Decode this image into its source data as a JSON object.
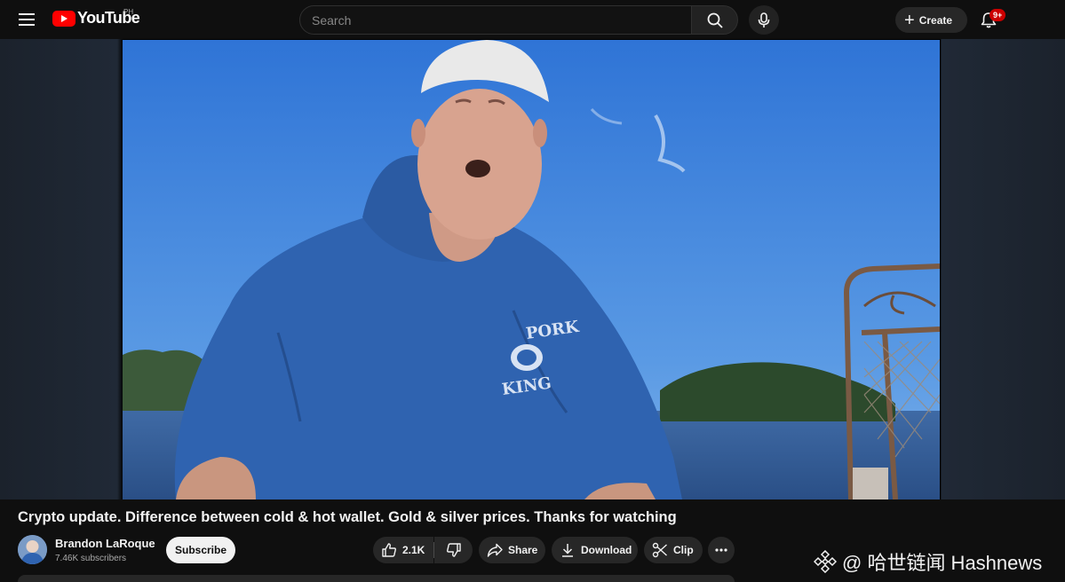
{
  "header": {
    "logo_text": "YouTube",
    "country_code": "PH",
    "search_placeholder": "Search",
    "create_label": "Create",
    "notification_count": "9+"
  },
  "video": {
    "title": "Crypto update. Difference between cold & hot wallet. Gold & silver prices. Thanks for watching",
    "hoodie_text_top": "PORK",
    "hoodie_text_bottom": "KING"
  },
  "channel": {
    "name": "Brandon LaRoque",
    "subscribers": "7.46K subscribers",
    "subscribe_label": "Subscribe"
  },
  "actions": {
    "like_count": "2.1K",
    "share_label": "Share",
    "download_label": "Download",
    "clip_label": "Clip"
  },
  "watermark": {
    "text": "@ 哈世链闻 Hashnews"
  },
  "colors": {
    "background": "#0f0f0f",
    "brand_red": "#ff0000",
    "pill_bg": "#272727",
    "badge_red": "#cc0000"
  }
}
